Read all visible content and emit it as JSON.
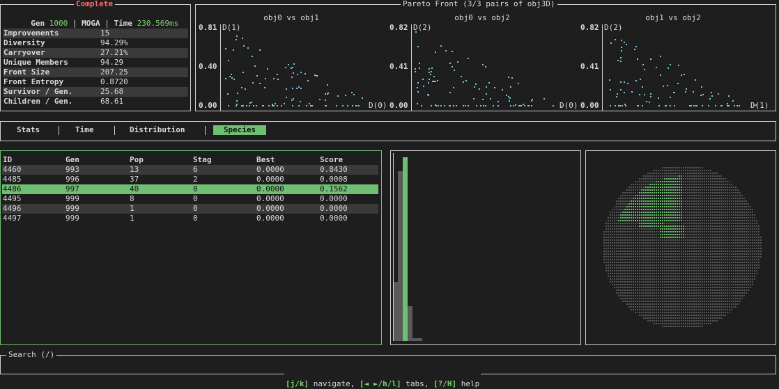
{
  "status": {
    "title": "Complete",
    "gen_label": "Gen",
    "gen_value": "1000",
    "algo": "MOGA",
    "time_label": "Time",
    "time_value": "230.569ms"
  },
  "stats": [
    {
      "k": "Improvements",
      "v": "15"
    },
    {
      "k": "Diversity",
      "v": "94.29%"
    },
    {
      "k": "Carryover",
      "v": "27.21%"
    },
    {
      "k": "Unique Members",
      "v": "94.29"
    },
    {
      "k": "Front Size",
      "v": "207.25"
    },
    {
      "k": "Front Entropy",
      "v": "0.8720"
    },
    {
      "k": "Survivor / Gen.",
      "v": "25.68"
    },
    {
      "k": "Children / Gen.",
      "v": "68.61"
    }
  ],
  "pareto": {
    "title": "Pareto Front (3/3 pairs of obj3D)",
    "panels": [
      {
        "name": "obj0 vs obj1",
        "ymax": "0.81",
        "ymid": "0.40",
        "ymin": "0.00",
        "ylabel": "D(1)",
        "xlabel": "D(0)"
      },
      {
        "name": "obj0 vs obj2",
        "ymax": "0.82",
        "ymid": "0.41",
        "ymin": "0.00",
        "ylabel": "D(2)",
        "xlabel": "D(0)"
      },
      {
        "name": "obj1 vs obj2",
        "ymax": "0.82",
        "ymid": "0.41",
        "ymin": "0.00",
        "ylabel": "D(2)",
        "xlabel": "D(1)"
      }
    ]
  },
  "tabs": [
    "Stats",
    "Time",
    "Distribution",
    "Species"
  ],
  "active_tab": "Species",
  "species": {
    "headers": [
      "ID",
      "Gen",
      "Pop",
      "Stag",
      "Best",
      "Score"
    ],
    "rows": [
      [
        "4460",
        "993",
        "13",
        "6",
        "0.0000",
        "0.8430"
      ],
      [
        "4485",
        "996",
        "37",
        "2",
        "0.0000",
        "0.0008"
      ],
      [
        "4486",
        "997",
        "40",
        "0",
        "0.0000",
        "0.1562"
      ],
      [
        "4495",
        "999",
        "8",
        "0",
        "0.0000",
        "0.0000"
      ],
      [
        "4496",
        "999",
        "1",
        "0",
        "0.0000",
        "0.0000"
      ],
      [
        "4497",
        "999",
        "1",
        "0",
        "0.0000",
        "0.0000"
      ]
    ],
    "selected_index": 2
  },
  "search": {
    "label": "Search (/)"
  },
  "help": {
    "k1": "[j/k]",
    "t1": " navigate, ",
    "k2": "[◄ ►/h/l]",
    "t2": " tabs, ",
    "k3": "[?/H]",
    "t3": " help"
  },
  "colors": {
    "accent": "#7fd36e",
    "selected_row": "#6fbf73",
    "dots": "#7fc6d4",
    "complete": "#ff6b6b"
  }
}
